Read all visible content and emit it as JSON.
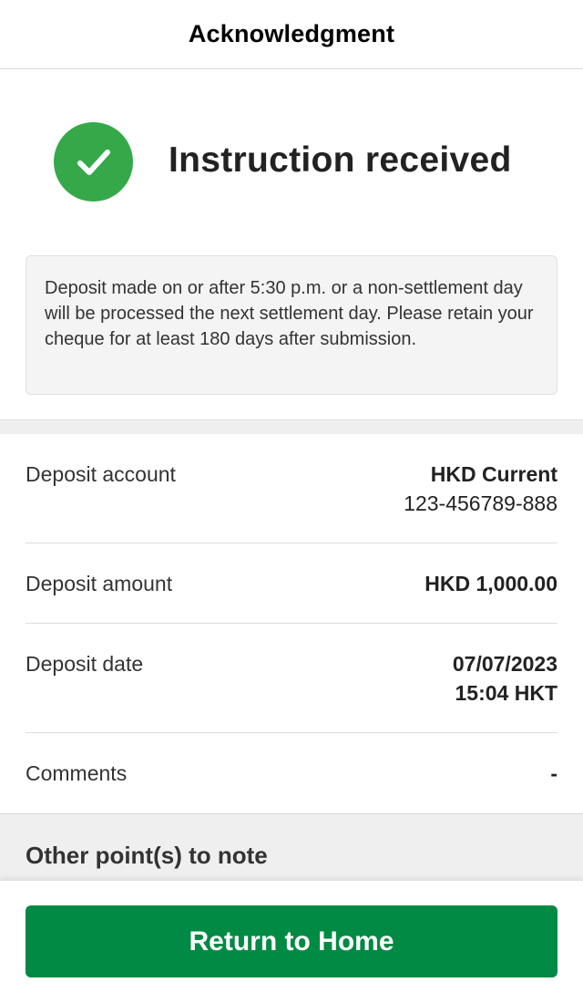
{
  "header": {
    "title": "Acknowledgment"
  },
  "status": {
    "icon": "check-circle-icon",
    "icon_color": "#35a94a",
    "message": "Instruction received"
  },
  "notice": {
    "text": "Deposit made on or after 5:30 p.m. or a non-settlement day will be processed the next settlement day. Please retain your cheque for at least 180 days after submission."
  },
  "details": {
    "account": {
      "label": "Deposit account",
      "value_primary": "HKD Current",
      "value_secondary": "123-456789-888"
    },
    "amount": {
      "label": "Deposit amount",
      "value": "HKD 1,000.00"
    },
    "date": {
      "label": "Deposit date",
      "value_date": "07/07/2023",
      "value_time": "15:04 HKT"
    },
    "comments": {
      "label": "Comments",
      "value": "-"
    }
  },
  "other": {
    "title": "Other point(s) to note"
  },
  "footer": {
    "button_label": "Return to Home",
    "button_color": "#008a43"
  }
}
